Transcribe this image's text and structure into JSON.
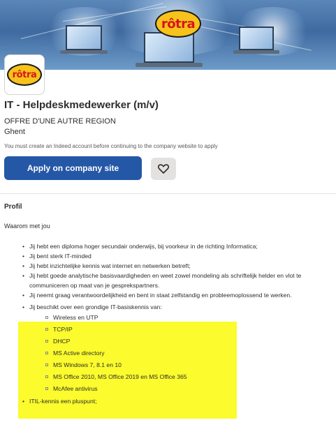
{
  "banner": {
    "logo_text": "rôtra"
  },
  "company_logo": {
    "text": "rôtra"
  },
  "job": {
    "title": "IT - Helpdeskmedewerker (m/v)",
    "company": "OFFRE D'UNE AUTRE REGION",
    "location": "Ghent",
    "notice": "You must create an Indeed account before continuing to the company website to apply",
    "apply_label": "Apply on company site"
  },
  "profile": {
    "heading": "Profil",
    "intro": "Waarom met jou",
    "items": [
      "Jij hebt een diploma hoger secundair onderwijs, bij voorkeur in de richting Informatica;",
      "Jij bent sterk IT-minded",
      "Jij hebt inzichtelijke kennis wat internet en netwerken betreft;",
      "Jij hebt goede analytische basisvaardigheden en weet zowel mondeling als schriftelijk helder en vlot te communiceren op maat van je gesprekspartners.",
      "Jij neemt graag verantwoordelijkheid en bent in staat zelfstandig en probleemoplossend te werken.",
      "Jij beschikt over een grondige IT-basiskennis van:"
    ],
    "subitems": [
      "Wireless en UTP",
      "TCP/IP",
      "DHCP",
      "MS Active directory",
      "MS Windows 7, 8.1 en 10",
      "MS Office 2010, MS Office 2019 en MS Office 365",
      "McAfee antivirus"
    ],
    "last_item": "ITIL-kennis een pluspunt;"
  },
  "colors": {
    "apply": "#2557a7",
    "highlight": "#fbfb2d",
    "logo_yellow": "#f6c21b",
    "logo_red": "#d7151b"
  }
}
